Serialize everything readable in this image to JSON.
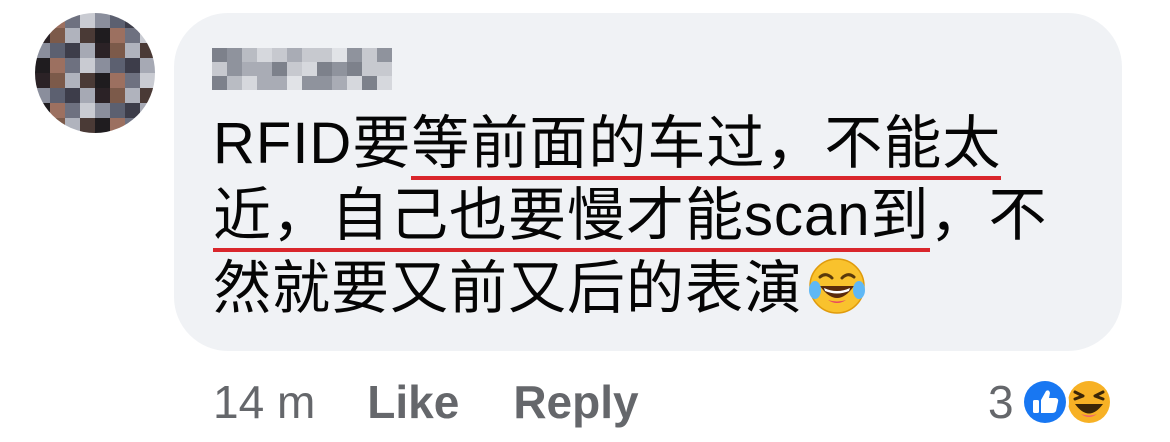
{
  "comment": {
    "author_name": "",
    "text_line1_pre": "RFID要",
    "text_line1_hl": "等前面的车过，不能太",
    "text_line2_hl": "近，自己也要慢才能scan到",
    "text_line2_post": "，不",
    "text_line3": "然就要又前又后的表演",
    "emoji": "laughing-with-tears-emoji",
    "highlight_color": "#d9262c"
  },
  "actions": {
    "time": "14 m",
    "like_label": "Like",
    "reply_label": "Reply"
  },
  "reactions": {
    "count": "3",
    "icons": [
      "like-reaction-icon",
      "haha-reaction-icon"
    ],
    "like_color": "#1877f2",
    "haha_color": "#f7b125"
  },
  "colors": {
    "bubble_bg": "#f0f2f5",
    "text": "#050505",
    "secondary": "#65676b"
  }
}
